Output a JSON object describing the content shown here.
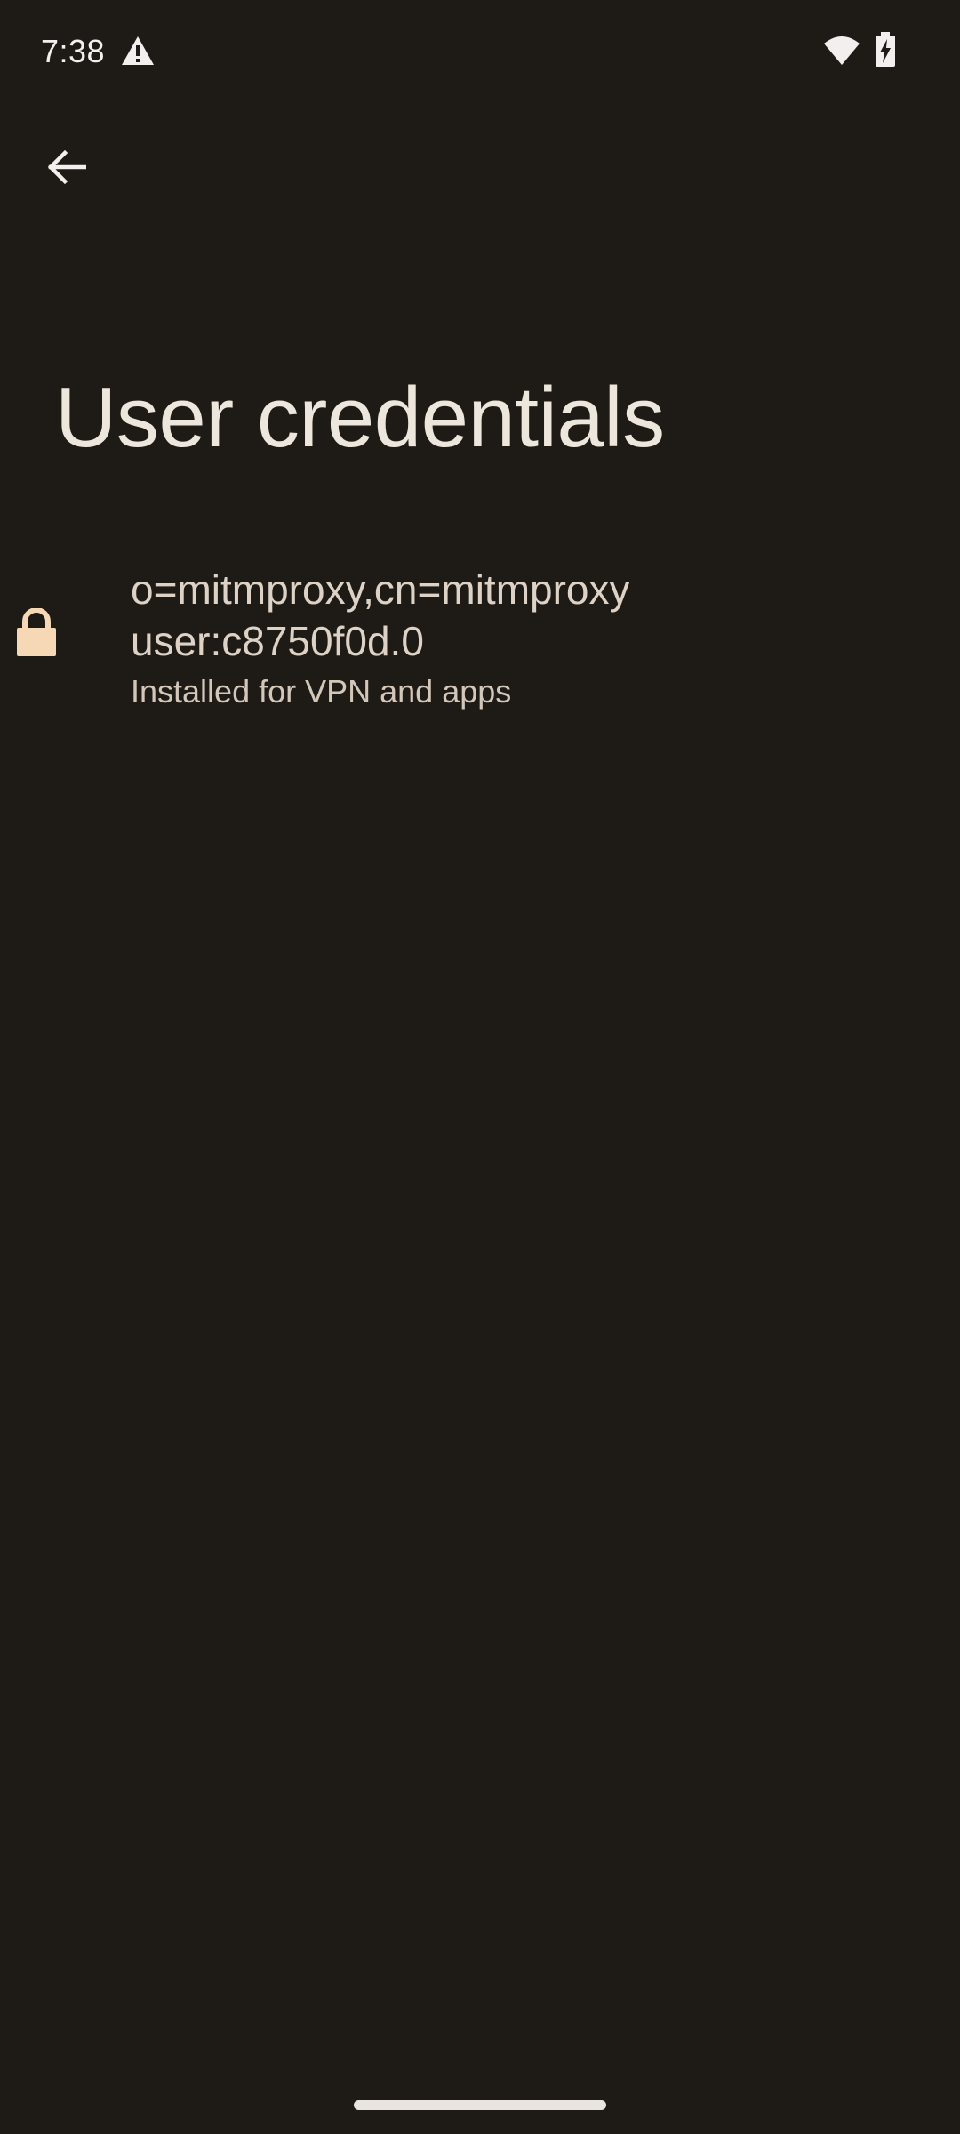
{
  "status_bar": {
    "time": "7:38",
    "icons": [
      "warning-icon",
      "wifi-icon",
      "battery-charging-icon"
    ]
  },
  "toolbar": {
    "back_icon": "arrow-back-icon"
  },
  "page": {
    "title": "User credentials"
  },
  "credentials": [
    {
      "icon": "lock-icon",
      "name": "o=mitmproxy,cn=mitmproxy user:c8750f0d.0",
      "summary": "Installed for VPN and apps"
    }
  ],
  "colors": {
    "background": "#1e1b17",
    "title_text": "#ede6dd",
    "item_text": "#ddd2c5",
    "lock_accent": "#f6d8b4"
  }
}
